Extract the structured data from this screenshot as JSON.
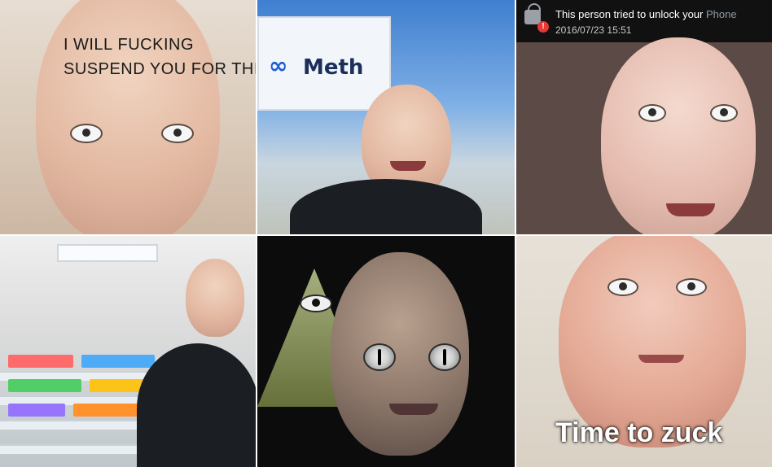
{
  "tile1": {
    "line1_words": [
      "I",
      "WILL",
      "FUCKING"
    ],
    "line2": "SUSPEND YOU FOR THIS"
  },
  "tile2": {
    "billboard_text": "Meth",
    "billboard_icon": "infinity-icon"
  },
  "tile3": {
    "notification": {
      "message_prefix": "This person tried to unlock your ",
      "message_accent": "Phone",
      "timestamp": "2016/07/23 15:51",
      "icons": [
        "lock-icon",
        "alert-icon"
      ],
      "alert_symbol": "!"
    }
  },
  "tile6": {
    "caption": "Time to zuck"
  },
  "colors": {
    "background": "#ffffff",
    "notification_bg": "#111111",
    "alert_red": "#e53935",
    "meta_blue": "#1b5fd6"
  }
}
